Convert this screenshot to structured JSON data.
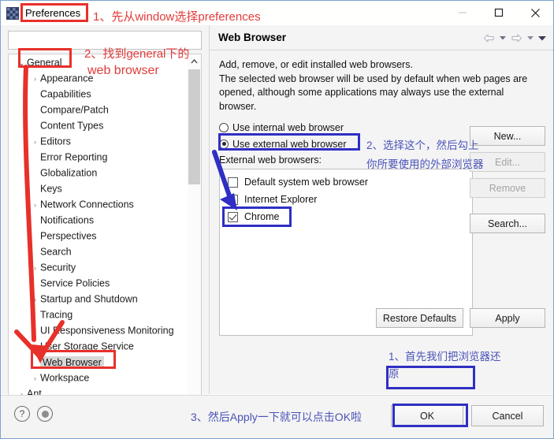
{
  "window": {
    "title": "Preferences",
    "controls": {
      "minimize": "minimize-icon",
      "maximize": "maximize-icon",
      "close": "close-icon"
    },
    "app_icon": "preferences-app-icon"
  },
  "search": {
    "value": "",
    "placeholder": ""
  },
  "tree": {
    "items": [
      {
        "label": "General",
        "level": 1,
        "arrow": "open",
        "selected": false
      },
      {
        "label": "Appearance",
        "level": 2,
        "arrow": "closed",
        "selected": false
      },
      {
        "label": "Capabilities",
        "level": 2,
        "arrow": "none",
        "selected": false
      },
      {
        "label": "Compare/Patch",
        "level": 2,
        "arrow": "none",
        "selected": false
      },
      {
        "label": "Content Types",
        "level": 2,
        "arrow": "none",
        "selected": false
      },
      {
        "label": "Editors",
        "level": 2,
        "arrow": "closed",
        "selected": false
      },
      {
        "label": "Error Reporting",
        "level": 2,
        "arrow": "none",
        "selected": false
      },
      {
        "label": "Globalization",
        "level": 2,
        "arrow": "none",
        "selected": false
      },
      {
        "label": "Keys",
        "level": 2,
        "arrow": "none",
        "selected": false
      },
      {
        "label": "Network Connections",
        "level": 2,
        "arrow": "closed",
        "selected": false
      },
      {
        "label": "Notifications",
        "level": 2,
        "arrow": "none",
        "selected": false
      },
      {
        "label": "Perspectives",
        "level": 2,
        "arrow": "none",
        "selected": false
      },
      {
        "label": "Search",
        "level": 2,
        "arrow": "none",
        "selected": false
      },
      {
        "label": "Security",
        "level": 2,
        "arrow": "closed",
        "selected": false
      },
      {
        "label": "Service Policies",
        "level": 2,
        "arrow": "none",
        "selected": false
      },
      {
        "label": "Startup and Shutdown",
        "level": 2,
        "arrow": "closed",
        "selected": false
      },
      {
        "label": "Tracing",
        "level": 2,
        "arrow": "none",
        "selected": false
      },
      {
        "label": "UI Responsiveness Monitoring",
        "level": 2,
        "arrow": "none",
        "selected": false
      },
      {
        "label": "User Storage Service",
        "level": 2,
        "arrow": "closed",
        "selected": false
      },
      {
        "label": "Web Browser",
        "level": 2,
        "arrow": "none",
        "selected": true
      },
      {
        "label": "Workspace",
        "level": 2,
        "arrow": "closed",
        "selected": false
      },
      {
        "label": "Ant",
        "level": 1,
        "arrow": "closed",
        "selected": false
      }
    ],
    "scroll_up_icon": "chevron-up-icon",
    "scroll_down_icon": "chevron-down-icon"
  },
  "pane": {
    "title": "Web Browser",
    "nav": {
      "back": "back-arrow-icon",
      "back_menu": "caret-down-icon",
      "forward": "forward-arrow-icon",
      "forward_menu": "caret-down-icon",
      "view_menu": "view-menu-icon"
    },
    "description": "Add, remove, or edit installed web browsers.\nThe selected web browser will be used by default when web pages are opened, although some applications may always use the external browser.",
    "radios": [
      {
        "label": "Use internal web browser",
        "selected": false
      },
      {
        "label": "Use external web browser",
        "selected": true
      }
    ],
    "external_label": "External web browsers:",
    "browsers": [
      {
        "label": "Default system web browser",
        "checked": false
      },
      {
        "label": "Internet Explorer",
        "checked": false
      },
      {
        "label": "Chrome",
        "checked": true
      }
    ],
    "side_buttons": [
      {
        "label": "New...",
        "enabled": true
      },
      {
        "label": "Edit...",
        "enabled": false
      },
      {
        "label": "Remove",
        "enabled": false
      },
      {
        "label": "Search...",
        "enabled": true
      }
    ],
    "bottom_buttons": [
      {
        "label": "Restore Defaults"
      },
      {
        "label": "Apply"
      }
    ]
  },
  "footer": {
    "help_icon": "help-question-icon",
    "record_icon": "record-circle-icon",
    "buttons": [
      {
        "label": "OK"
      },
      {
        "label": "Cancel"
      }
    ]
  },
  "annotations": {
    "colors": {
      "red": "#e8302a",
      "blue": "#2f2fc4"
    },
    "texts": [
      {
        "id": "step1",
        "text": "1、先从window选择preferences",
        "color": "red"
      },
      {
        "id": "step2a",
        "text": "2、找到general下的",
        "color": "red"
      },
      {
        "id": "step2b",
        "text": "web browser",
        "color": "red"
      },
      {
        "id": "step2c",
        "text": "2、选择这个，然后勾上",
        "color": "blue"
      },
      {
        "id": "step2d",
        "text": "你所要使用的外部浏览器",
        "color": "blue"
      },
      {
        "id": "step1b",
        "text": "1、首先我们把浏览器还",
        "color": "blue"
      },
      {
        "id": "step1c",
        "text": "原",
        "color": "blue"
      },
      {
        "id": "step3",
        "text": "3、然后Apply一下就可以点击OK啦",
        "color": "blue"
      }
    ]
  }
}
